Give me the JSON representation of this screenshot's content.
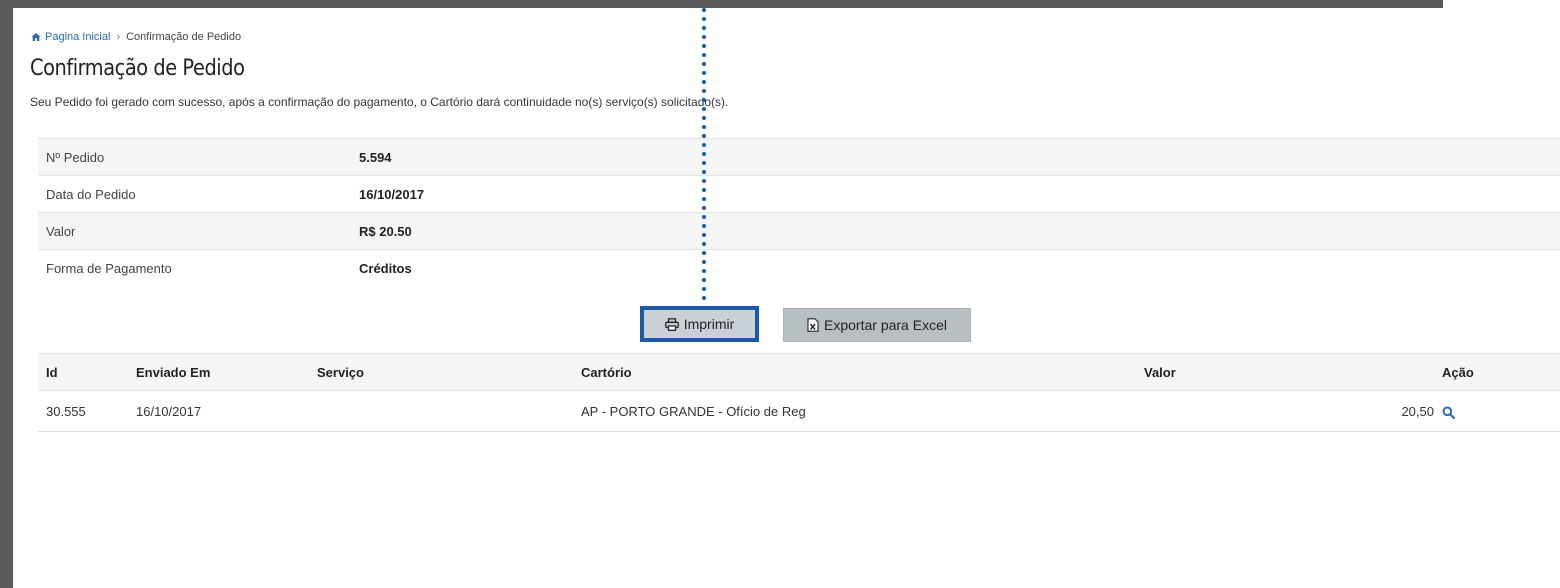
{
  "breadcrumb": {
    "home_label": "Pagina Inicial",
    "separator": "›",
    "current": "Confirmação de Pedido"
  },
  "page": {
    "title": "Confirmação de Pedido",
    "subtitle": "Seu Pedido foi gerado com sucesso, após a confirmação do pagamento, o Cartório dará continuidade no(s) serviço(s) solicitado(s)."
  },
  "order_info": [
    {
      "label": "Nº Pedido",
      "value": "5.594"
    },
    {
      "label": "Data do Pedido",
      "value": "16/10/2017"
    },
    {
      "label": "Valor",
      "value": "R$ 20.50"
    },
    {
      "label": "Forma de Pagamento",
      "value": "Créditos"
    }
  ],
  "buttons": {
    "print_label": "Imprimir",
    "excel_label": "Exportar para Excel"
  },
  "results": {
    "headers": {
      "id": "Id",
      "sent": "Enviado Em",
      "service": "Serviço",
      "registry": "Cartório",
      "value": "Valor",
      "action": "Ação"
    },
    "rows": [
      {
        "id": "30.555",
        "sent": "16/10/2017",
        "service": "",
        "registry": "AP - PORTO GRANDE - Ofício de Reg",
        "value": "20,50"
      }
    ]
  },
  "colors": {
    "frame": "#5a5a5a",
    "link": "#2b6cb0",
    "highlight_border": "#1d5aa6",
    "stripe": "#f5f5f5"
  },
  "icons": [
    "home-icon",
    "printer-icon",
    "excel-icon",
    "search-icon"
  ]
}
